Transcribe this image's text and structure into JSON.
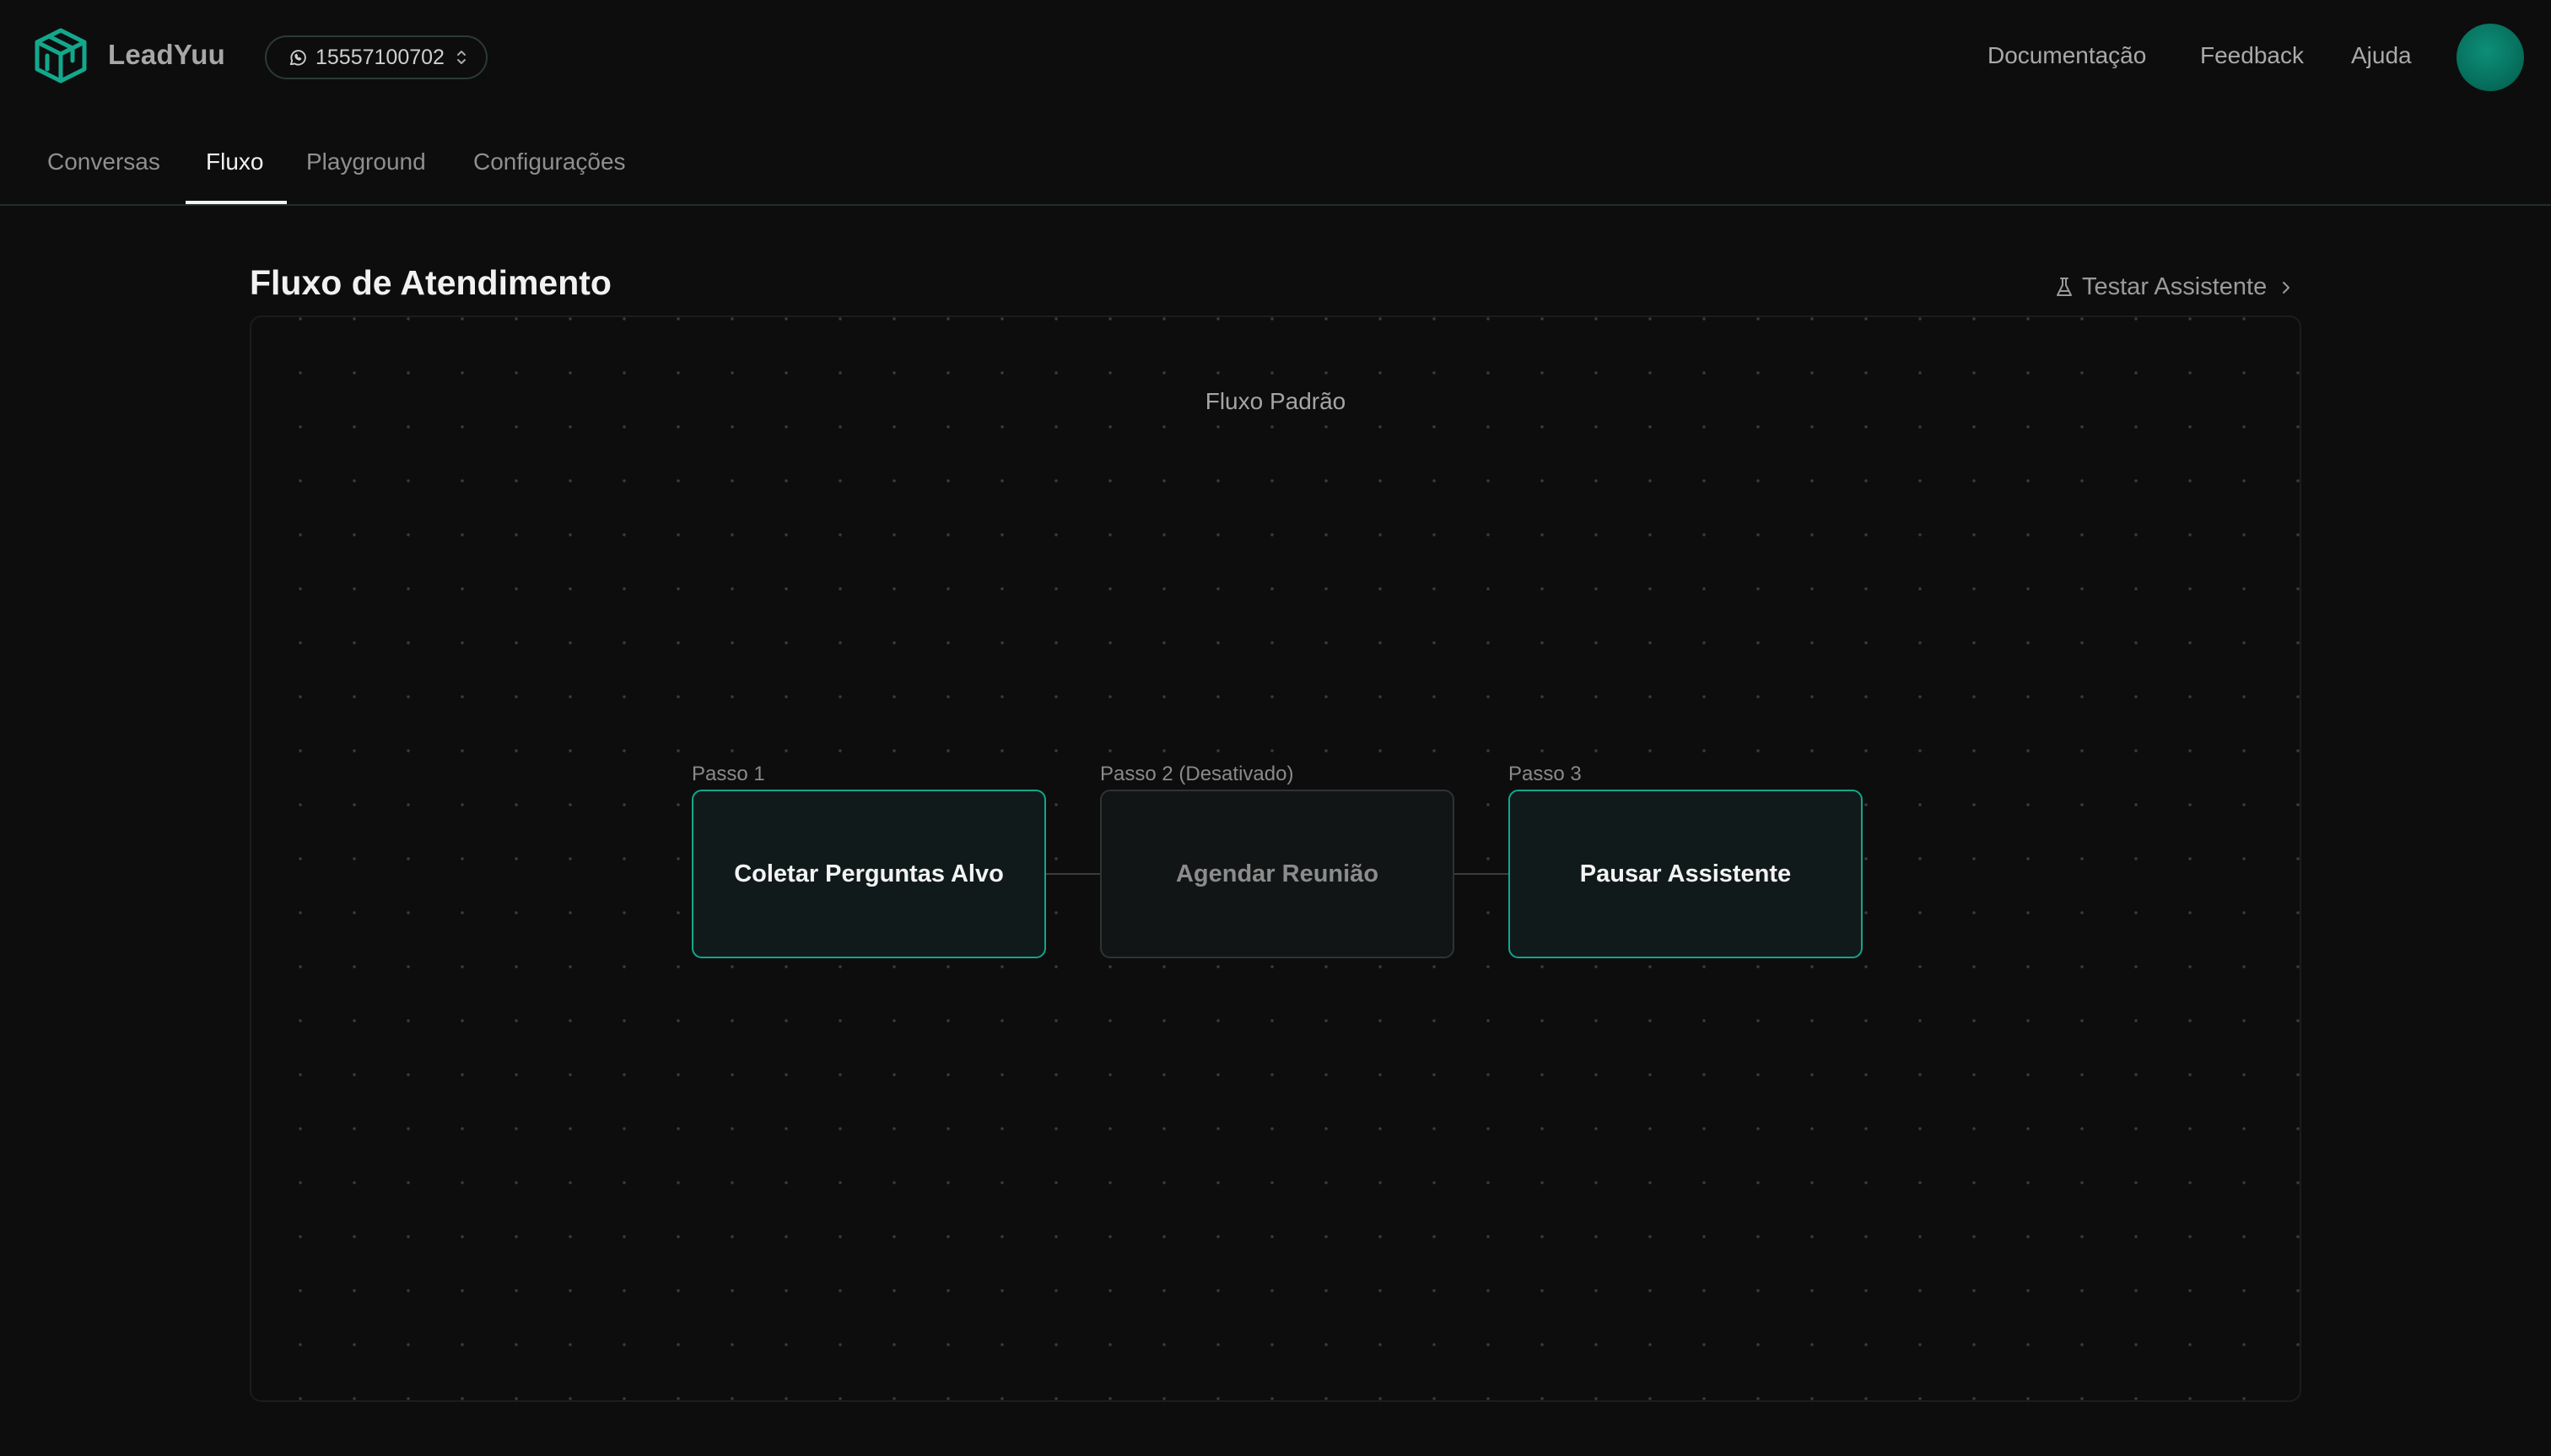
{
  "header": {
    "brand": "LeadYuu",
    "phone_number": "15557100702",
    "links": {
      "docs": "Documentação",
      "feedback": "Feedback",
      "help": "Ajuda"
    }
  },
  "tabs": [
    {
      "label": "Conversas",
      "active": false
    },
    {
      "label": "Fluxo",
      "active": true
    },
    {
      "label": "Playground",
      "active": false
    },
    {
      "label": "Configurações",
      "active": false
    }
  ],
  "main": {
    "title": "Fluxo de Atendimento",
    "test_link": "Testar Assistente",
    "flow_name": "Fluxo Padrão",
    "steps": [
      {
        "label": "Passo 1",
        "title": "Coletar Perguntas Alvo",
        "enabled": true
      },
      {
        "label": "Passo 2 (Desativado)",
        "title": "Agendar Reunião",
        "enabled": false
      },
      {
        "label": "Passo 3",
        "title": "Pausar Assistente",
        "enabled": true
      }
    ]
  },
  "colors": {
    "accent": "#11a68b",
    "background": "#0d0d0d",
    "avatar": "#06705d"
  },
  "icons": {
    "logo": "cube-logo-icon",
    "phone": "whatsapp-icon",
    "selector": "chevron-up-down-icon",
    "test": "flask-icon",
    "test_arrow": "chevron-right-icon"
  }
}
